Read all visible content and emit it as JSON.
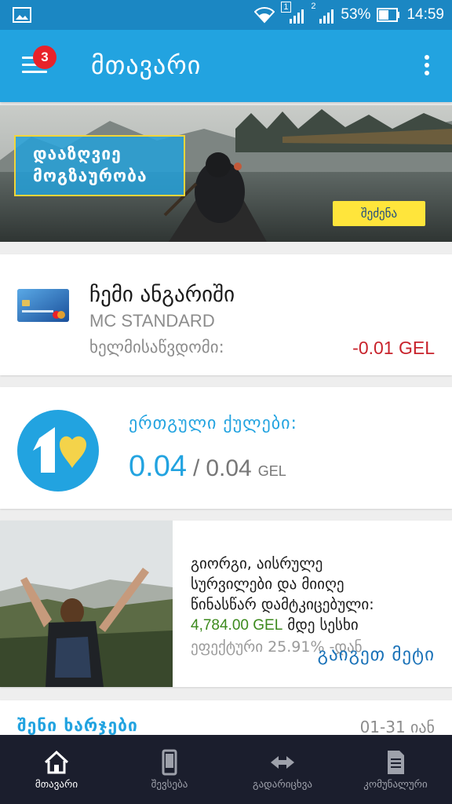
{
  "status_bar": {
    "sim1": "1",
    "sim2": "2",
    "battery": "53%",
    "time": "14:59"
  },
  "app_bar": {
    "title": "მთავარი",
    "badge_count": "3"
  },
  "banner": {
    "promo_line1": "დააზღვიე",
    "promo_line2": "მოგზაურობა",
    "button_label": "შეძენა"
  },
  "account": {
    "title": "ჩემი ანგარიში",
    "card_type": "MC STANDARD",
    "available_label": "ხელმისაწვდომი:",
    "balance": "-0.01 GEL"
  },
  "loyalty": {
    "title": "ერთგული ქულები:",
    "current": "0.04",
    "separator": "/",
    "total": "0.04",
    "unit": "GEL"
  },
  "offer": {
    "line1": "გიორგი, აისრულე",
    "line2": "სურვილები და მიიღე",
    "line3": "წინასწარ დამტკიცებული:",
    "amount": "4,784.00 GEL",
    "amount_suffix": " მდე სესხი",
    "rate": "ეფექტური 25.91% -დან",
    "more_label": "გაიგეთ მეტი"
  },
  "expenses": {
    "title": "შენი ხარჯები",
    "range": "01-31 იან"
  },
  "bottom_nav": [
    {
      "label": "მთავარი",
      "icon": "home-icon",
      "active": true
    },
    {
      "label": "შევსება",
      "icon": "phone-icon",
      "active": false
    },
    {
      "label": "გადარიცხვა",
      "icon": "transfer-icon",
      "active": false
    },
    {
      "label": "კომუნალური",
      "icon": "bill-icon",
      "active": false
    }
  ],
  "colors": {
    "status_bar": "#1b87c3",
    "app_bar": "#22a3e0",
    "badge": "#e8222a",
    "promo_button": "#ffe53b",
    "negative_balance": "#c8232c",
    "offer_amount": "#3c8a1d",
    "bottom_nav": "#1b1e2d"
  }
}
